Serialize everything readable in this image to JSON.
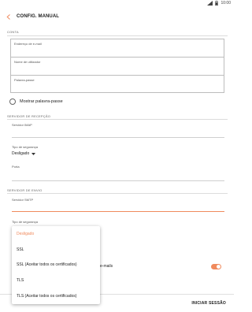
{
  "status": {
    "time": "10:00"
  },
  "header": {
    "title": "CONFIG. MANUAL"
  },
  "account": {
    "section": "CONTA",
    "email_placeholder": "Endereço de e-mail",
    "username_placeholder": "Nome de utilizador",
    "password_placeholder": "Palavra-passe",
    "show_password": "Mostrar palavra-passe"
  },
  "incoming": {
    "section": "SERVIDOR DE RECEPÇÃO",
    "server_label": "Servidor IMAP",
    "security_label": "Tipo de segurança",
    "security_value": "Desligado",
    "port_label": "Porta"
  },
  "outgoing": {
    "section": "SERVIDOR DE ENVIO",
    "server_label": "Servidor SMTP",
    "security_label": "Tipo de segurança",
    "toggle_text_partial": "e-mails"
  },
  "dropdown": {
    "options": [
      "Desligado",
      "SSL",
      "SSL (Aceitar todos os certificados)",
      "TLS",
      "TLS (Aceitar todos os certificados)"
    ],
    "selected_index": 0
  },
  "footer": {
    "sign_in": "INICIAR SESSÃO"
  },
  "colors": {
    "accent": "#f08a5d"
  }
}
